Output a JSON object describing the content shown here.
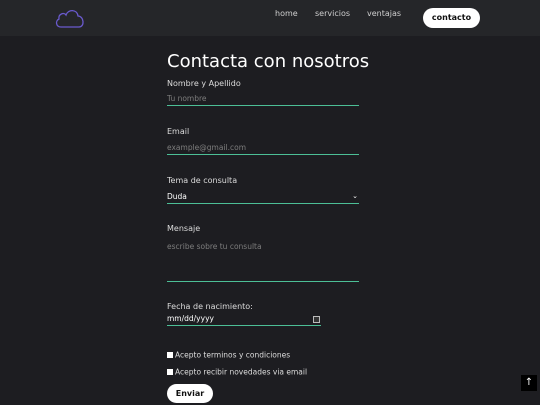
{
  "nav": {
    "logo_icon": "cloud-icon",
    "links": [
      "home",
      "servicios",
      "ventajas"
    ],
    "cta": "contacto"
  },
  "form": {
    "title": "Contacta con nosotros",
    "name": {
      "label": "Nombre y Apellido",
      "placeholder": "Tu nombre"
    },
    "email": {
      "label": "Email",
      "placeholder": "example@gmail.com"
    },
    "topic": {
      "label": "Tema de consulta",
      "value": "Duda"
    },
    "message": {
      "label": "Mensaje",
      "placeholder": "escribe sobre tu consulta"
    },
    "birthdate": {
      "label": "Fecha de nacimiento:",
      "value": "mm/dd/yyyy"
    },
    "terms": "Acepto terminos y condiciones",
    "newsletter": "Acepto recibir novedades via email",
    "submit": "Enviar"
  },
  "scroll_top_icon": "arrow-up-icon",
  "colors": {
    "accent": "#4cbf96",
    "background": "#1d1d21",
    "navbar": "#252629",
    "logo": "#6a5acd"
  }
}
